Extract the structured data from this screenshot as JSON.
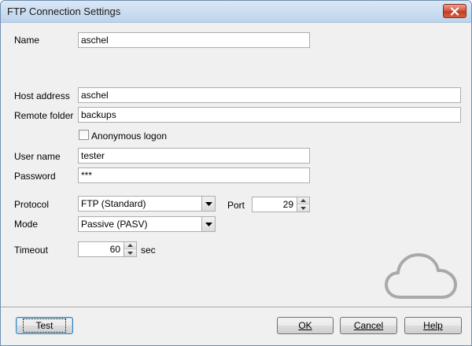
{
  "window": {
    "title": "FTP Connection Settings"
  },
  "form": {
    "name": {
      "label": "Name",
      "value": "aschel"
    },
    "host": {
      "label": "Host address",
      "value": "aschel"
    },
    "remote_folder": {
      "label": "Remote folder",
      "value": "backups"
    },
    "anonymous": {
      "label": "Anonymous logon",
      "checked": false
    },
    "user_name": {
      "label": "User name",
      "value": "tester"
    },
    "password": {
      "label": "Password",
      "value": "***"
    },
    "protocol": {
      "label": "Protocol",
      "value": "FTP (Standard)"
    },
    "port": {
      "label": "Port",
      "value": "29"
    },
    "mode": {
      "label": "Mode",
      "value": "Passive (PASV)"
    },
    "timeout": {
      "label": "Timeout",
      "value": "60",
      "unit": "sec"
    }
  },
  "buttons": {
    "test": "Test",
    "ok": "OK",
    "cancel": "Cancel",
    "help": "Help"
  },
  "icons": {
    "close": "close-icon",
    "cloud": "cloud-icon"
  },
  "colors": {
    "close_button": "#c23b22",
    "titlebar": "#c9dcf0",
    "dialog_background": "#f0f0f0",
    "cloud_stroke": "#a9a9a9"
  }
}
